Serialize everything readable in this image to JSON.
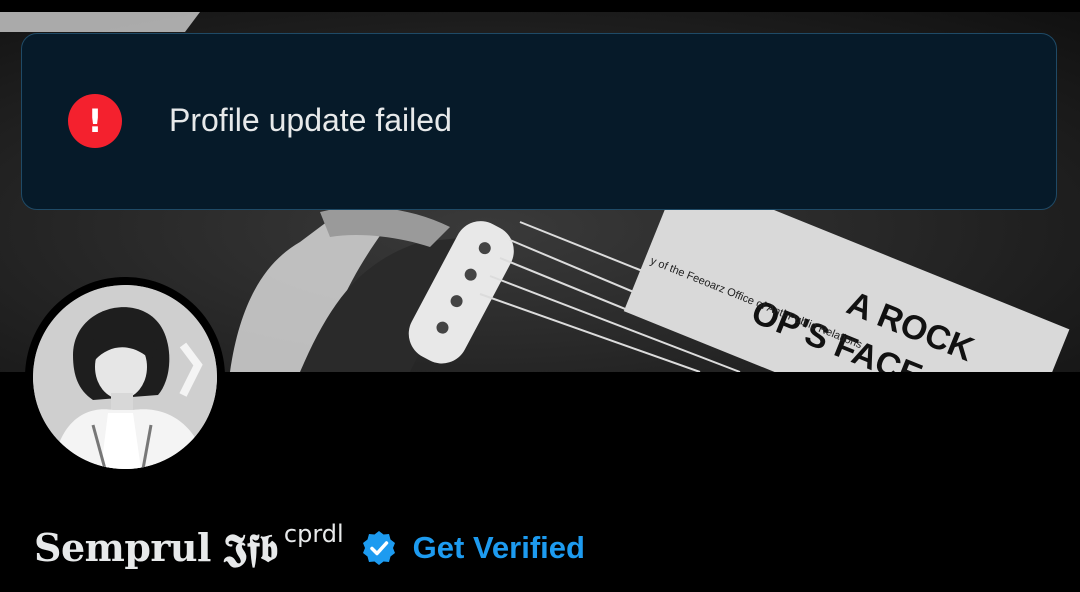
{
  "toast": {
    "icon": "exclamation-alert-icon",
    "icon_glyph": "!",
    "message": "Profile update failed",
    "background": "#061a29",
    "icon_color": "#f4212e"
  },
  "banner": {
    "sticker_line1": "A ROCK",
    "sticker_line2": "OP'S FACE",
    "sticker_fine_print": "y of the Feeoarz Office of Anti-Public Relations"
  },
  "profile": {
    "display_name": "Semprul 𝕵𝖋𝖇",
    "display_name_suffix": "cprdl",
    "badge_icon": "verified-badge-icon",
    "get_verified_label": "Get Verified",
    "accent": "#1d9bf0"
  }
}
